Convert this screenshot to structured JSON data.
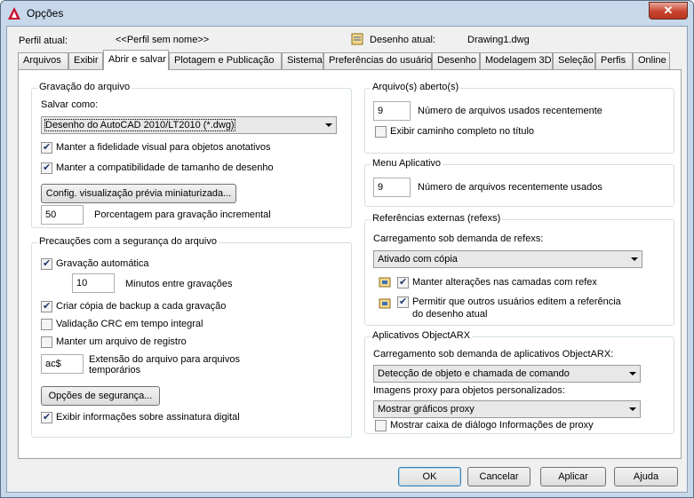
{
  "window": {
    "title": "Opções",
    "close": "✕"
  },
  "header": {
    "profile_label": "Perfil atual:",
    "profile_value": "<<Perfil sem nome>>",
    "drawing_label": "Desenho atual:",
    "drawing_value": "Drawing1.dwg"
  },
  "tabs": [
    "Arquivos",
    "Exibir",
    "Abrir e salvar",
    "Plotagem e Publicação",
    "Sistema",
    "Preferências do usuário",
    "Desenho",
    "Modelagem 3D",
    "Seleção",
    "Perfis",
    "Online"
  ],
  "active_tab": "Abrir e salvar",
  "file_save": {
    "title": "Gravação do arquivo",
    "save_as_label": "Salvar como:",
    "save_as_value": "Desenho do AutoCAD 2010/LT2010 (*.dwg)",
    "visual_fidelity": {
      "label": "Manter a fidelidade visual para objetos anotativos",
      "checked": true
    },
    "size_compat": {
      "label": "Manter a compatibilidade de tamanho de desenho",
      "checked": true
    },
    "thumbnail_button": "Config. visualização prévia miniaturizada...",
    "incremental_value": "50",
    "incremental_label": "Porcentagem para gravação incremental"
  },
  "safety": {
    "title": "Precauções com a segurança do arquivo",
    "autosave": {
      "label": "Gravação automática",
      "checked": true
    },
    "minutes_value": "10",
    "minutes_label": "Minutos entre gravações",
    "backup": {
      "label": "Criar cópia de backup a cada gravação",
      "checked": true
    },
    "crc": {
      "label": "Validação CRC em tempo integral",
      "checked": false
    },
    "log": {
      "label": "Manter um arquivo de registro",
      "checked": false
    },
    "temp_ext_value": "ac$",
    "temp_ext_label_1": "Extensão do arquivo para arquivos",
    "temp_ext_label_2": "temporários",
    "security_button": "Opções de segurança...",
    "digital_sig": {
      "label": "Exibir informações sobre assinatura digital",
      "checked": true
    }
  },
  "open_files": {
    "title": "Arquivo(s) aberto(s)",
    "recent_value": "9",
    "recent_label": "Número de arquivos usados recentemente",
    "full_path": {
      "label": "Exibir caminho completo no título",
      "checked": false
    }
  },
  "app_menu": {
    "title": "Menu Aplicativo",
    "recent_value": "9",
    "recent_label": "Número de arquivos recentemente usados"
  },
  "xrefs": {
    "title": "Referências externas (refexs)",
    "demand_label": "Carregamento sob demanda de refexs:",
    "demand_value": "Ativado com cópia",
    "retain_layers": {
      "label": "Manter alterações nas camadas com refex",
      "checked": true
    },
    "allow_edit": {
      "label_1": "Permitir que outros usuários editem a referência",
      "label_2": "do desenho atual",
      "checked": true
    }
  },
  "objectarx": {
    "title": "Aplicativos ObjectARX",
    "demand_label": "Carregamento sob demanda de aplicativos ObjectARX:",
    "demand_value": "Detecção de objeto e chamada de comando",
    "proxy_label": "Imagens proxy para objetos personalizados:",
    "proxy_value": "Mostrar gráficos proxy",
    "proxy_dialog": {
      "label": "Mostrar caixa de diálogo Informações de proxy",
      "checked": false
    }
  },
  "buttons": {
    "ok": "OK",
    "cancel": "Cancelar",
    "apply": "Aplicar",
    "help": "Ajuda"
  }
}
